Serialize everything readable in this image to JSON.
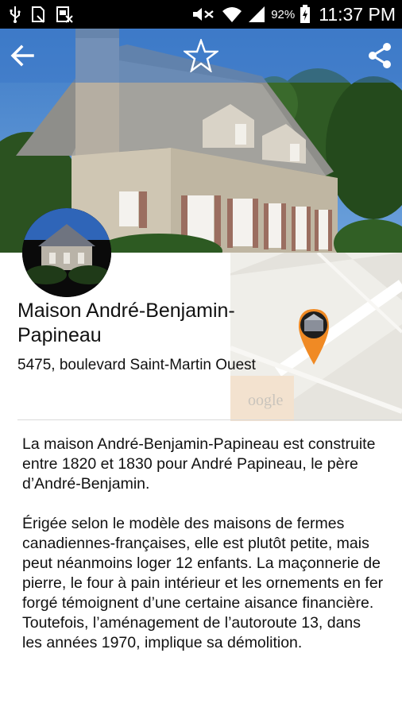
{
  "status_bar": {
    "battery_percent": "92%",
    "time": "11:37 PM",
    "icons": [
      "usb-icon",
      "sim-card-icon",
      "sim-toolkit-icon",
      "mute-icon",
      "wifi-icon",
      "signal-icon",
      "battery-charging-icon"
    ]
  },
  "action_bar": {
    "back_icon": "arrow-back-icon",
    "favorite_icon": "star-outline-icon",
    "share_icon": "share-icon"
  },
  "place": {
    "title": "Maison André-Benjamin-Papineau",
    "address": "5475, boulevard Saint-Martin Ouest"
  },
  "map": {
    "watermark": "oogle"
  },
  "description": {
    "paragraphs": [
      "La maison André-Benjamin-Papineau est construite entre 1820 et 1830 pour André Papineau, le père d’André-Benjamin.",
      "Érigée selon le modèle des maisons de fermes canadiennes-françaises, elle est plutôt petite, mais peut néanmoins loger 12 enfants. La maçonnerie de pierre, le four à pain intérieur et les ornements en fer forgé témoignent d’une certaine aisance financière. Toutefois, l’aménagement de l’autoroute 13, dans les années 1970, implique sa démolition."
    ]
  },
  "colors": {
    "action_bar": "#3c78c8",
    "pin": "#f08a24",
    "text": "#111111"
  }
}
